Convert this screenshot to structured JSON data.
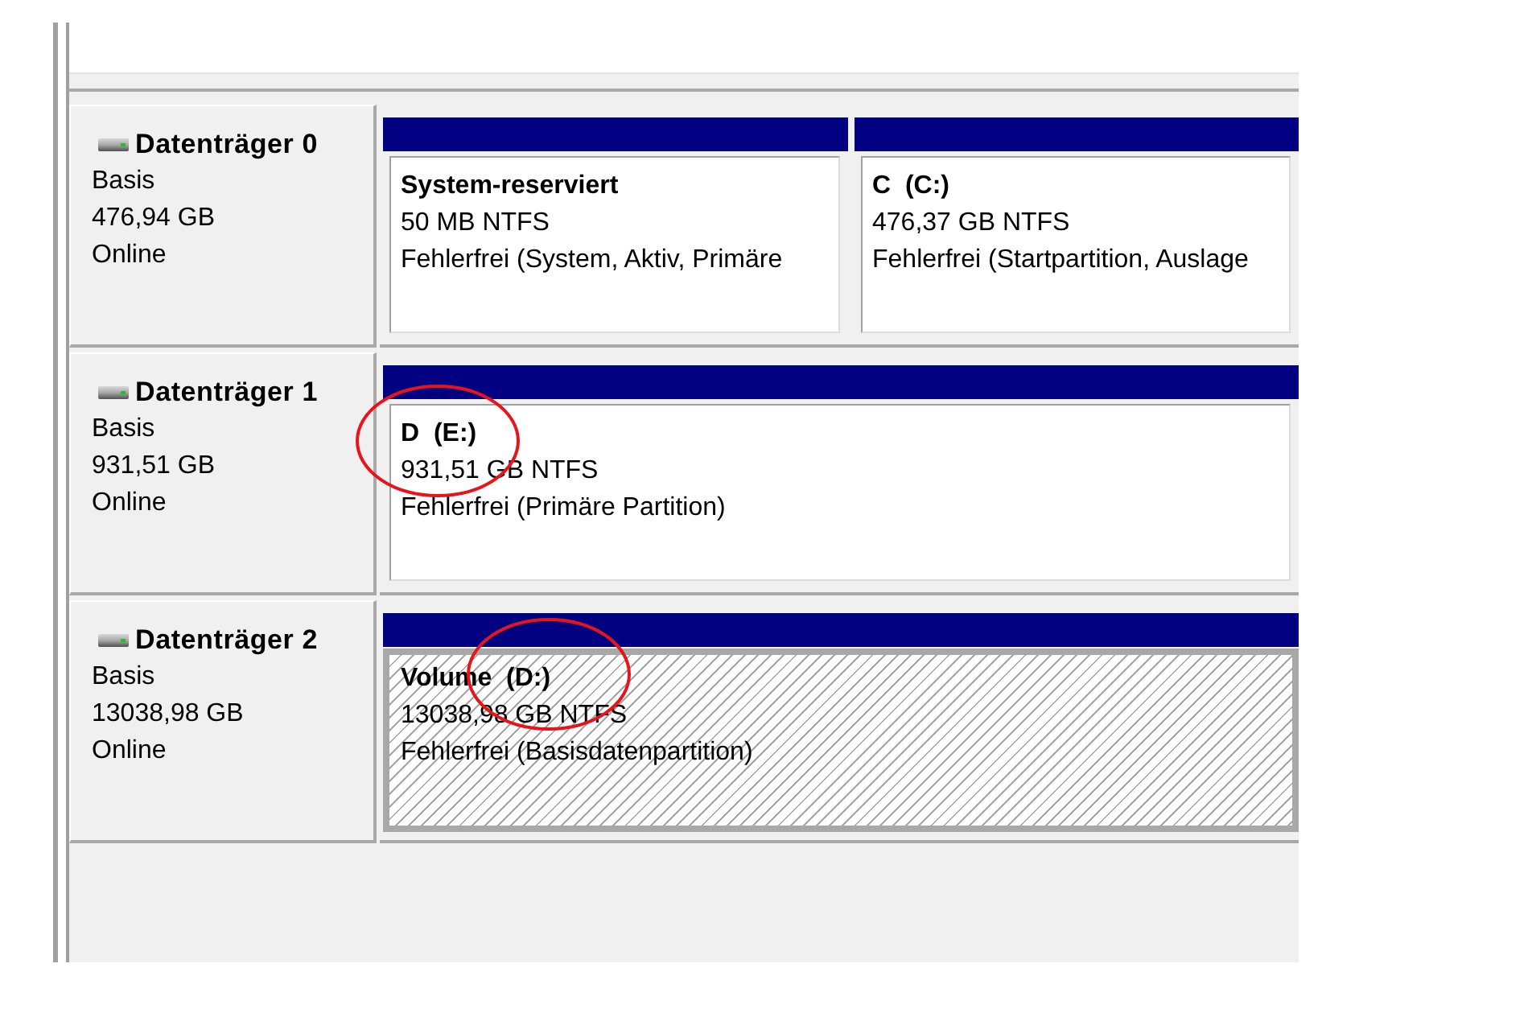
{
  "disks": [
    {
      "name": "Datenträger 0",
      "type": "Basis",
      "size": "476,94 GB",
      "status": "Online",
      "partitions": [
        {
          "title": "System-reserviert",
          "size": "50 MB NTFS",
          "status": "Fehlerfrei (System, Aktiv, Primäre",
          "selected": false,
          "circled": false
        },
        {
          "title": "C  (C:)",
          "size": "476,37 GB NTFS",
          "status": "Fehlerfrei (Startpartition, Auslage",
          "selected": false,
          "circled": false
        }
      ]
    },
    {
      "name": "Datenträger 1",
      "type": "Basis",
      "size": "931,51 GB",
      "status": "Online",
      "partitions": [
        {
          "title": "D  (E:)",
          "size": "931,51 GB NTFS",
          "status": "Fehlerfrei (Primäre Partition)",
          "selected": false,
          "circled": true
        }
      ]
    },
    {
      "name": "Datenträger 2",
      "type": "Basis",
      "size": "13038,98 GB",
      "status": "Online",
      "partitions": [
        {
          "title": "Volume  (D:)",
          "size": "13038,98 GB NTFS",
          "status": "Fehlerfrei (Basisdatenpartition)",
          "selected": true,
          "circled": true
        }
      ]
    }
  ]
}
